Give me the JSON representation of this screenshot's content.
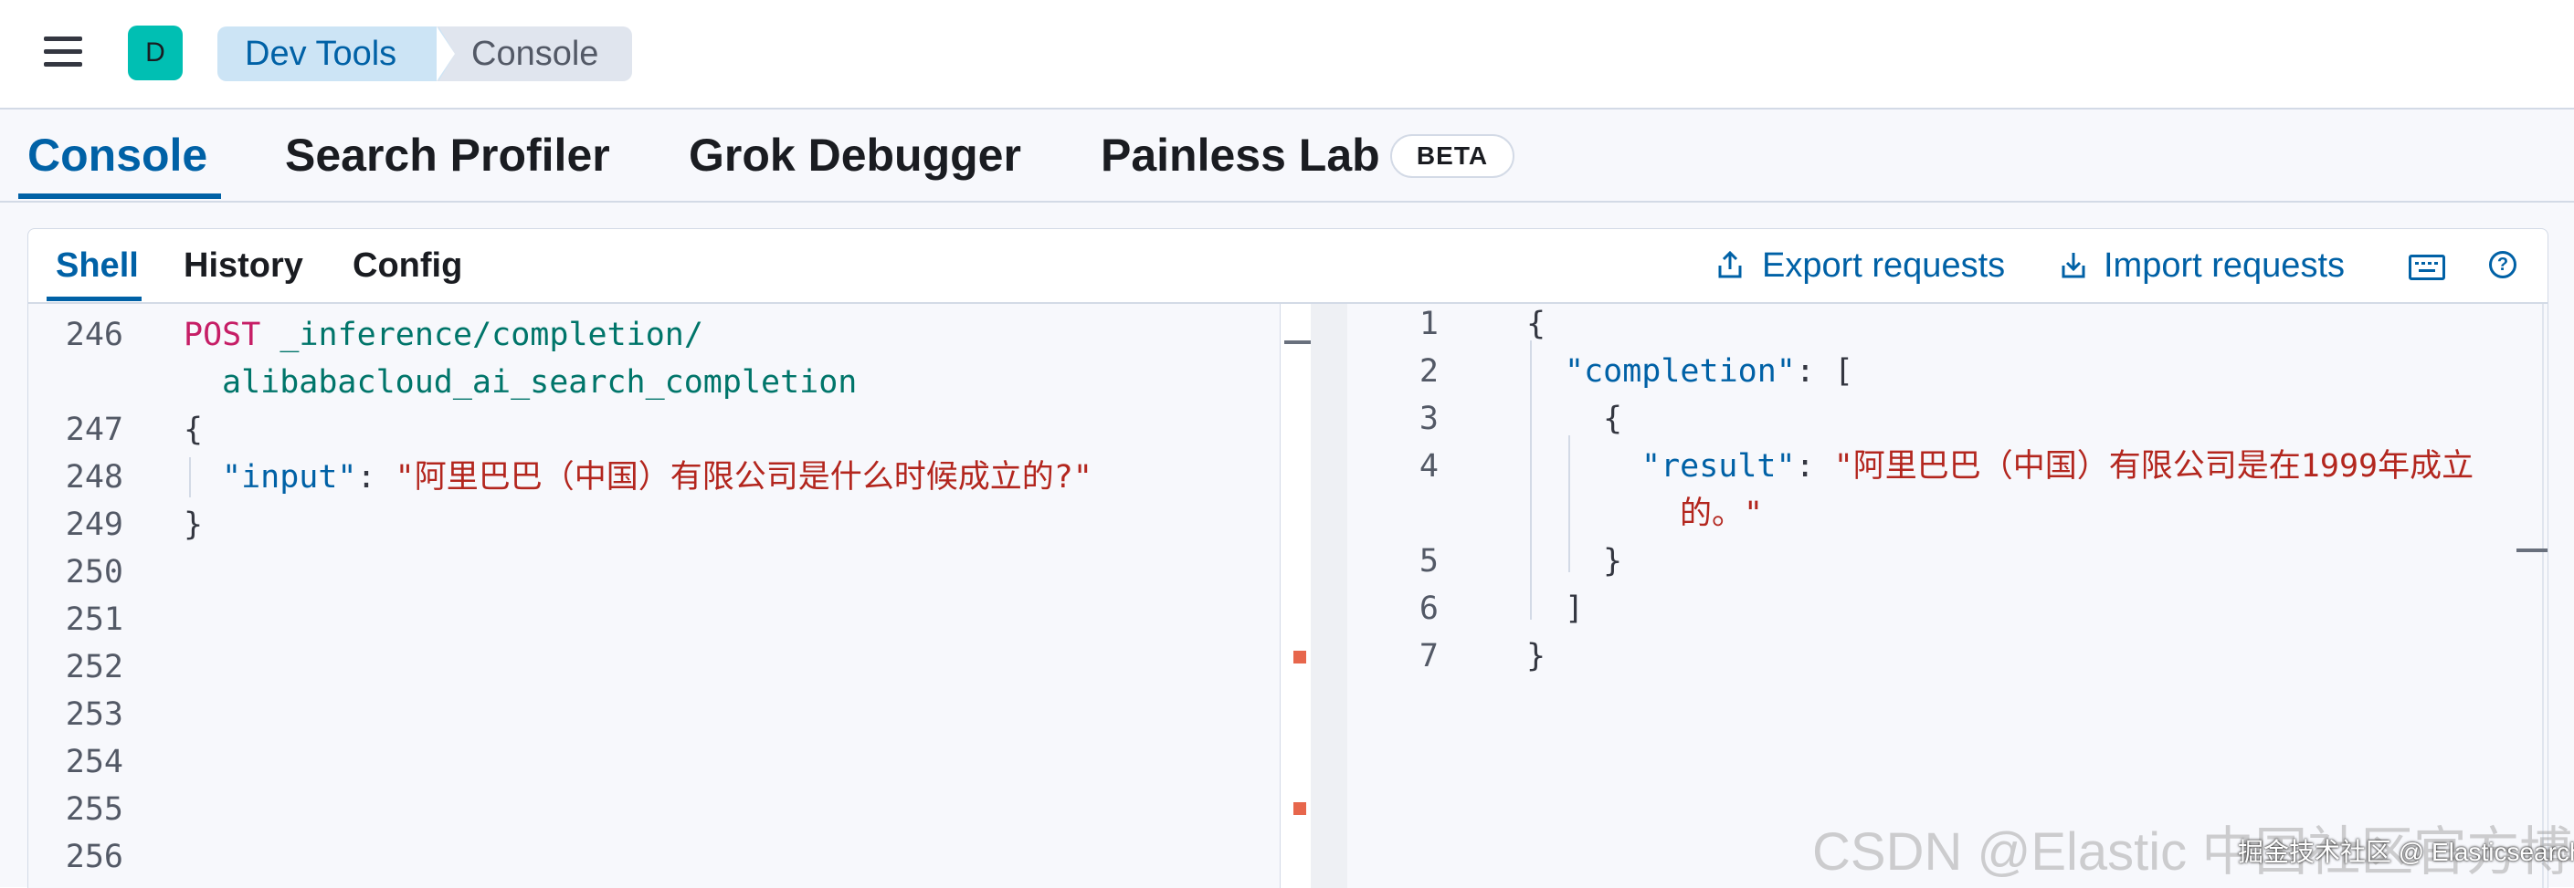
{
  "header": {
    "avatar_letter": "D",
    "breadcrumbs": [
      "Dev Tools",
      "Console"
    ]
  },
  "main_tabs": [
    {
      "label": "Console",
      "active": true
    },
    {
      "label": "Search Profiler",
      "active": false
    },
    {
      "label": "Grok Debugger",
      "active": false
    },
    {
      "label": "Painless Lab",
      "active": false
    }
  ],
  "beta_badge": "BETA",
  "sub_tabs": [
    {
      "label": "Shell",
      "active": true
    },
    {
      "label": "History",
      "active": false
    },
    {
      "label": "Config",
      "active": false
    }
  ],
  "actions": {
    "export": "Export requests",
    "import": "Import requests"
  },
  "request_editor": {
    "line_numbers": [
      "246",
      "247",
      "248",
      "249",
      "250",
      "251",
      "252",
      "253",
      "254",
      "255",
      "256"
    ],
    "method": "POST",
    "path_part1": "_inference/completion/",
    "path_part2": "alibabacloud_ai_search_completion",
    "open_brace": "{",
    "input_key": "\"input\"",
    "colon": ": ",
    "input_value": "\"阿里巴巴（中国）有限公司是什么时候成立的?\"",
    "close_brace": "}"
  },
  "response_editor": {
    "line_numbers": [
      "1",
      "2",
      "3",
      "4",
      "5",
      "6",
      "7"
    ],
    "line1": "{",
    "completion_key": "\"completion\"",
    "completion_rest": ": [",
    "obj_open": "{",
    "result_key": "\"result\"",
    "result_colon": ": ",
    "result_value_part1": "\"阿里巴巴（中国）有限公司是在1999年成立",
    "result_value_part2": "的。\"",
    "obj_close": "}",
    "array_close": "]",
    "line7": "}"
  },
  "watermark": {
    "main": "CSDN @Elastic 中国社区官方博客",
    "overlay": "掘金技术社区 @ Elasticsearch"
  },
  "colors": {
    "accent": "#0061a6",
    "avatar_bg": "#00bfb3",
    "breadcrumb_active_bg": "#cce4f5",
    "string": "#b3261e",
    "url": "#00756a",
    "method": "#c61e66",
    "error_marker": "#e7664c"
  }
}
